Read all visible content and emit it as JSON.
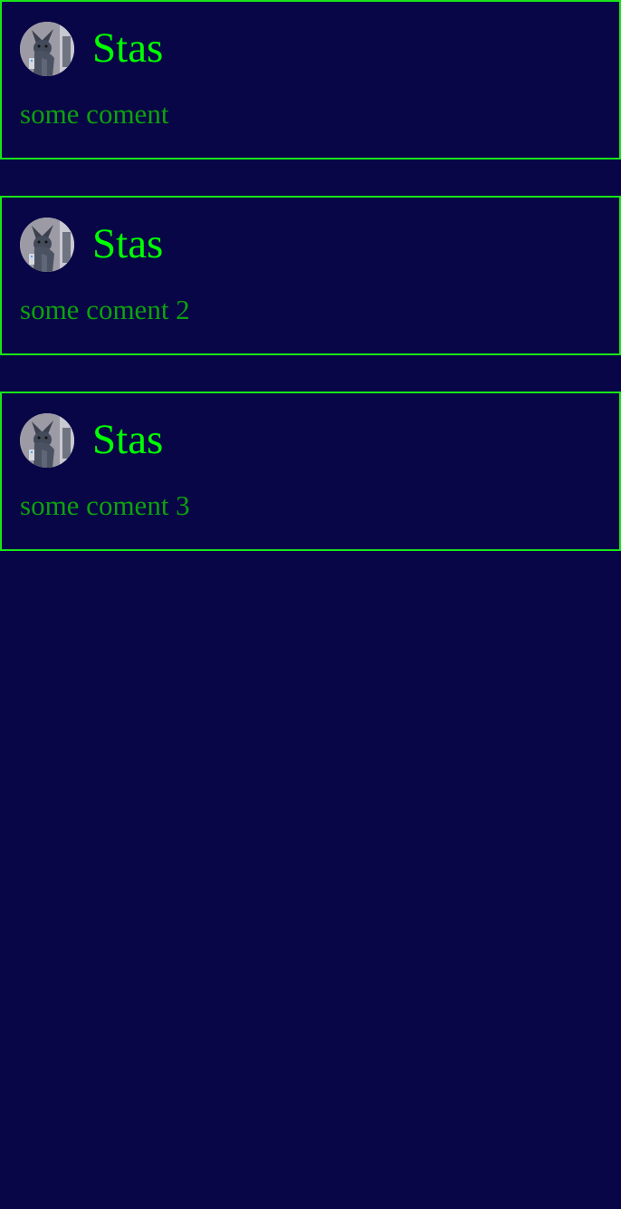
{
  "theme": {
    "background": "#080646",
    "border": "#19e619",
    "author_color": "#00ff00",
    "comment_color": "#0ea10e"
  },
  "comments": [
    {
      "author": "Stas",
      "avatar_icon": "dog-avatar-icon",
      "text": "some coment"
    },
    {
      "author": "Stas",
      "avatar_icon": "dog-avatar-icon",
      "text": "some coment 2"
    },
    {
      "author": "Stas",
      "avatar_icon": "dog-avatar-icon",
      "text": "some coment 3"
    }
  ]
}
